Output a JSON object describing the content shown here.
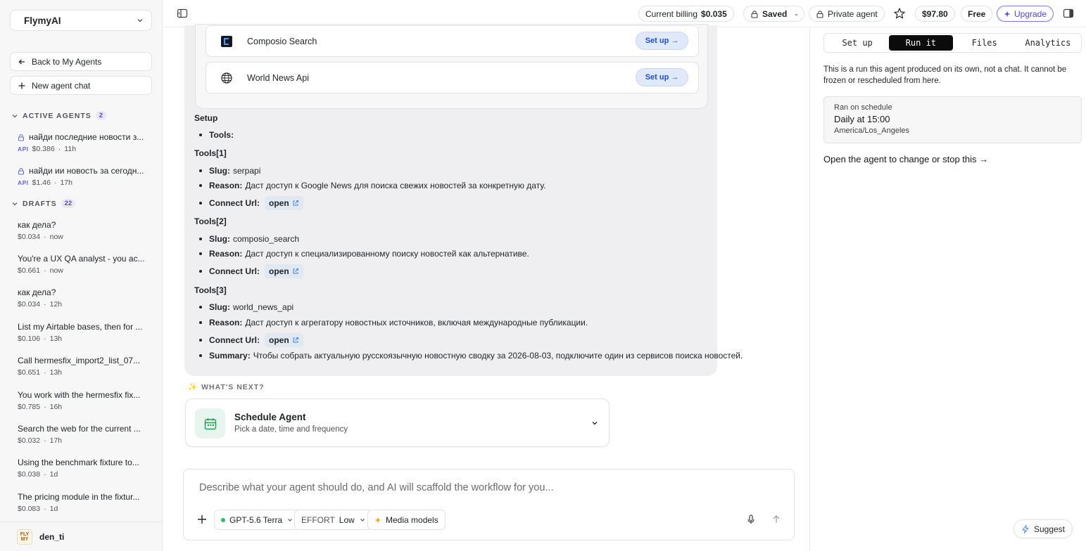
{
  "sidebar": {
    "workspace": "FlymyAI",
    "back_label": "Back to My Agents",
    "new_chat_label": "New agent chat",
    "active": {
      "heading": "ACTIVE AGENTS",
      "count": "2",
      "items": [
        {
          "title": "найди последние новости з...",
          "badge": "API",
          "cost": "$0.386",
          "time": "11h"
        },
        {
          "title": "найди ии новость за сегодн...",
          "badge": "API",
          "cost": "$1.46",
          "time": "17h"
        }
      ]
    },
    "drafts": {
      "heading": "DRAFTS",
      "count": "22",
      "items": [
        {
          "title": "как дела?",
          "cost": "$0.034",
          "time": "now"
        },
        {
          "title": "You're a UX QA analyst - you ac...",
          "cost": "$0.661",
          "time": "now"
        },
        {
          "title": "как дела?",
          "cost": "$0.034",
          "time": "12h"
        },
        {
          "title": "List my Airtable bases, then for ...",
          "cost": "$0.106",
          "time": "13h"
        },
        {
          "title": "Call hermesfix_import2_list_07...",
          "cost": "$0.651",
          "time": "13h"
        },
        {
          "title": "You work with the hermesfix fix...",
          "cost": "$0.785",
          "time": "16h"
        },
        {
          "title": "Search the web for the current ...",
          "cost": "$0.032",
          "time": "17h"
        },
        {
          "title": "Using the benchmark fixture to...",
          "cost": "$0.038",
          "time": "1d"
        },
        {
          "title": "The pricing module in the fixtur...",
          "cost": "$0.083",
          "time": "1d"
        }
      ]
    },
    "user": {
      "name": "den_ti",
      "avatar_text": "FLY MY AI"
    }
  },
  "topbar": {
    "billing_label": "Current billing",
    "billing_value": "$0.035",
    "saved_label": "Saved",
    "saved_suffix": "-",
    "private_label": "Private agent",
    "balance": "$97.80",
    "plan": "Free",
    "upgrade_label": "Upgrade"
  },
  "tools_card": {
    "rows": [
      {
        "name": "Composio Search",
        "button": "Set up"
      },
      {
        "name": "World News Api",
        "button": "Set up"
      }
    ]
  },
  "message": {
    "setup_heading": "Setup",
    "tools_label": "Tools:",
    "sections": [
      {
        "heading": "Tools[1]",
        "slug_label": "Slug:",
        "slug": "serpapi",
        "reason_label": "Reason:",
        "reason": "Даст доступ к Google News для поиска свежих новостей за конкретную дату.",
        "connect_label": "Connect Url:",
        "open": "open"
      },
      {
        "heading": "Tools[2]",
        "slug_label": "Slug:",
        "slug": "composio_search",
        "reason_label": "Reason:",
        "reason": "Даст доступ к специализированному поиску новостей как альтернативе.",
        "connect_label": "Connect Url:",
        "open": "open"
      },
      {
        "heading": "Tools[3]",
        "slug_label": "Slug:",
        "slug": "world_news_api",
        "reason_label": "Reason:",
        "reason": "Даст доступ к агрегатору новостных источников, включая международные публикации.",
        "connect_label": "Connect Url:",
        "open": "open"
      }
    ],
    "summary_label": "Summary:",
    "summary": "Чтобы собрать актуальную русскоязычную новостную сводку за 2026-08-03, подключите один из сервисов поиска новостей."
  },
  "whats_next": {
    "heading": "WHAT'S NEXT?",
    "card_title": "Schedule Agent",
    "card_sub": "Pick a date, time and frequency"
  },
  "composer": {
    "placeholder": "Describe what your agent should do, and AI will scaffold the workflow for you...",
    "model": "GPT-5.6 Terra",
    "effort_label": "EFFORT",
    "effort_value": "Low",
    "media_label": "Media models"
  },
  "right_panel": {
    "tabs": [
      {
        "label": "Set up",
        "active": false
      },
      {
        "label": "Run it",
        "active": true
      },
      {
        "label": "Files",
        "active": false
      },
      {
        "label": "Analytics",
        "active": false
      }
    ],
    "note": "This is a run this agent produced on its own, not a chat. It cannot be frozen or rescheduled from here.",
    "card": {
      "line1": "Ran on schedule",
      "line2": "Daily at 15:00",
      "line3": "America/Los_Angeles"
    },
    "link": "Open the agent to change or stop this →",
    "suggest": "Suggest"
  },
  "colors": {
    "accent": "#4f46e5",
    "setup_button_bg": "#e0e9fb",
    "active_tab_bg": "#0b0b0c",
    "schedule_icon_bg": "#e8f5ee"
  }
}
